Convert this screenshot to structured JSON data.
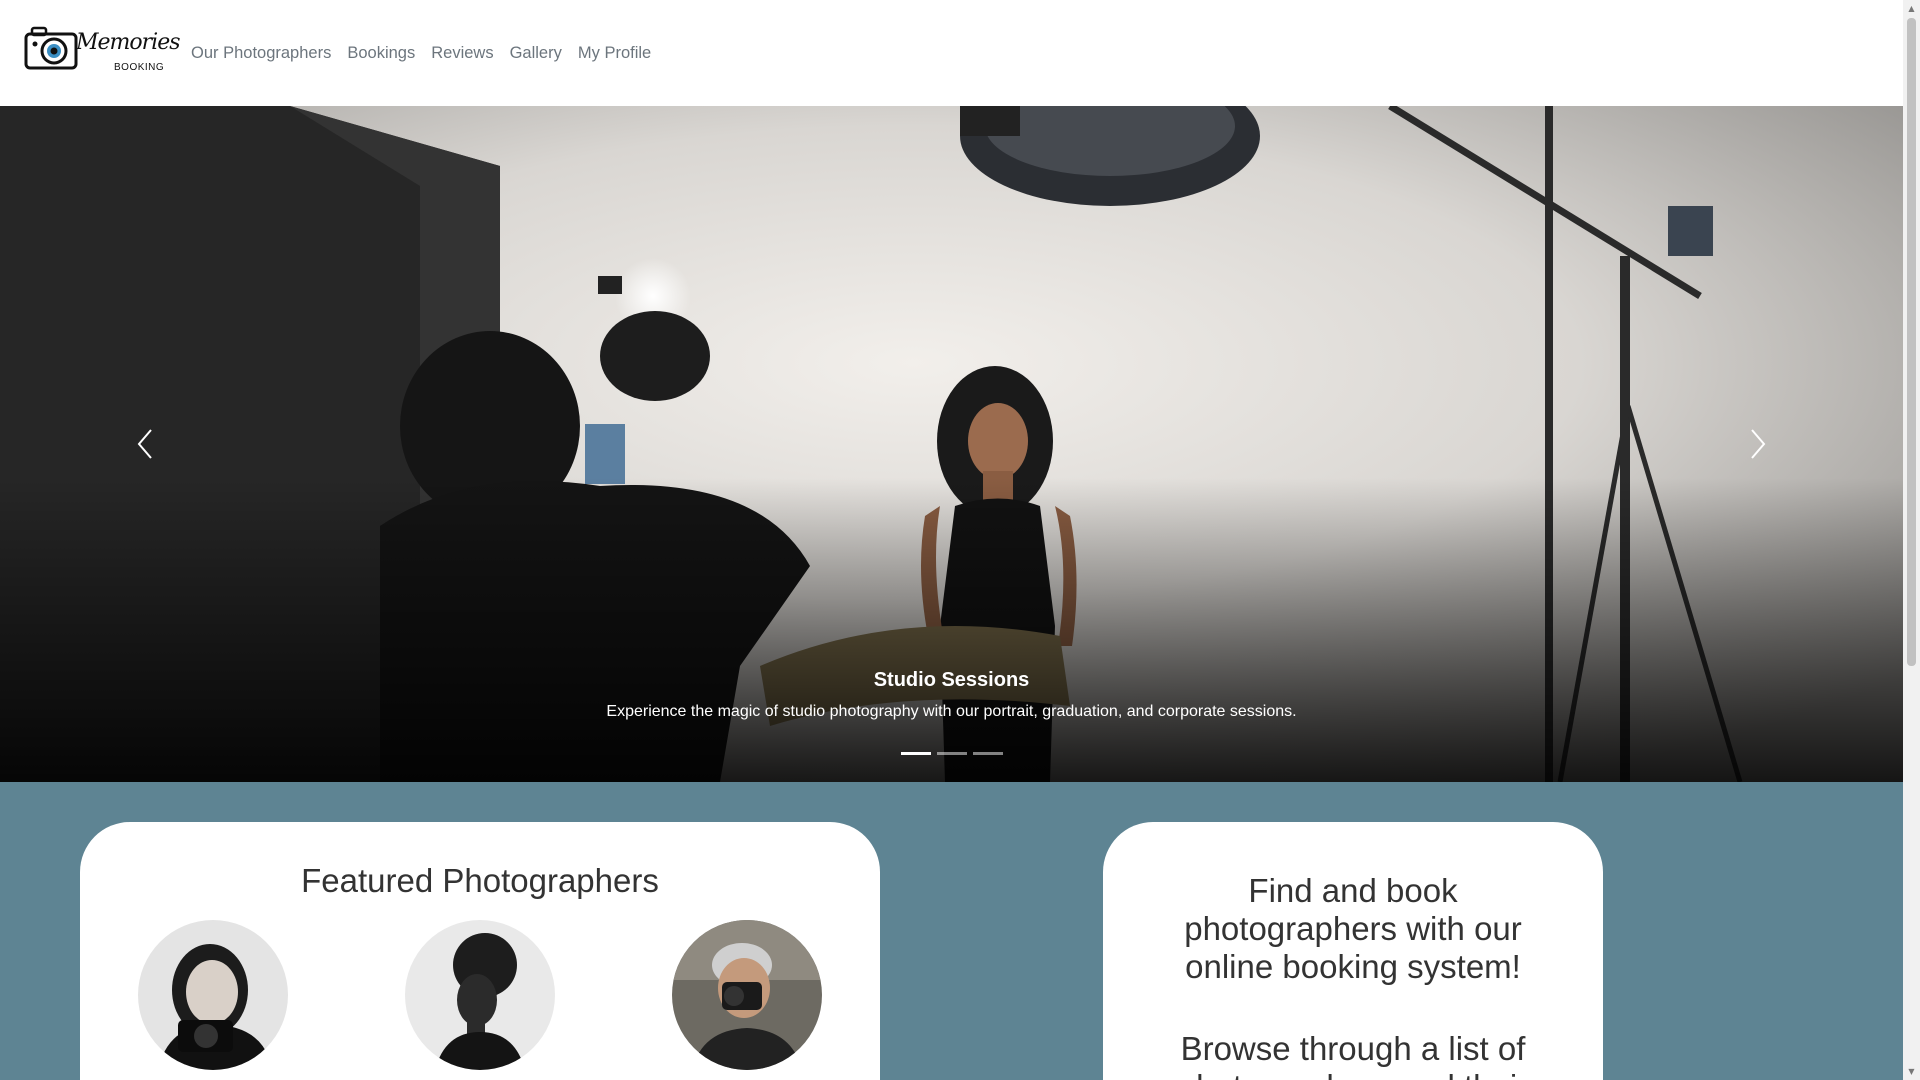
{
  "brand": {
    "logo_script": "Memories",
    "logo_sub": "BOOKING"
  },
  "nav": {
    "links": [
      "Our Photographers",
      "Bookings",
      "Reviews",
      "Gallery",
      "My Profile"
    ]
  },
  "carousel": {
    "caption_title": "Studio Sessions",
    "caption_text": "Experience the magic of studio photography with our portrait, graduation, and corporate sessions.",
    "slide_count": 3,
    "active_slide": 1,
    "prev_icon": "chevron-left-icon",
    "next_icon": "chevron-right-icon"
  },
  "featured": {
    "title": "Featured Photographers"
  },
  "info": {
    "line1": "Find and book photographers with our online booking system!",
    "line2": "Browse through a list of photographers and their"
  },
  "colors": {
    "section_bg": "#5e8493",
    "nav_link": "#6c757d"
  }
}
